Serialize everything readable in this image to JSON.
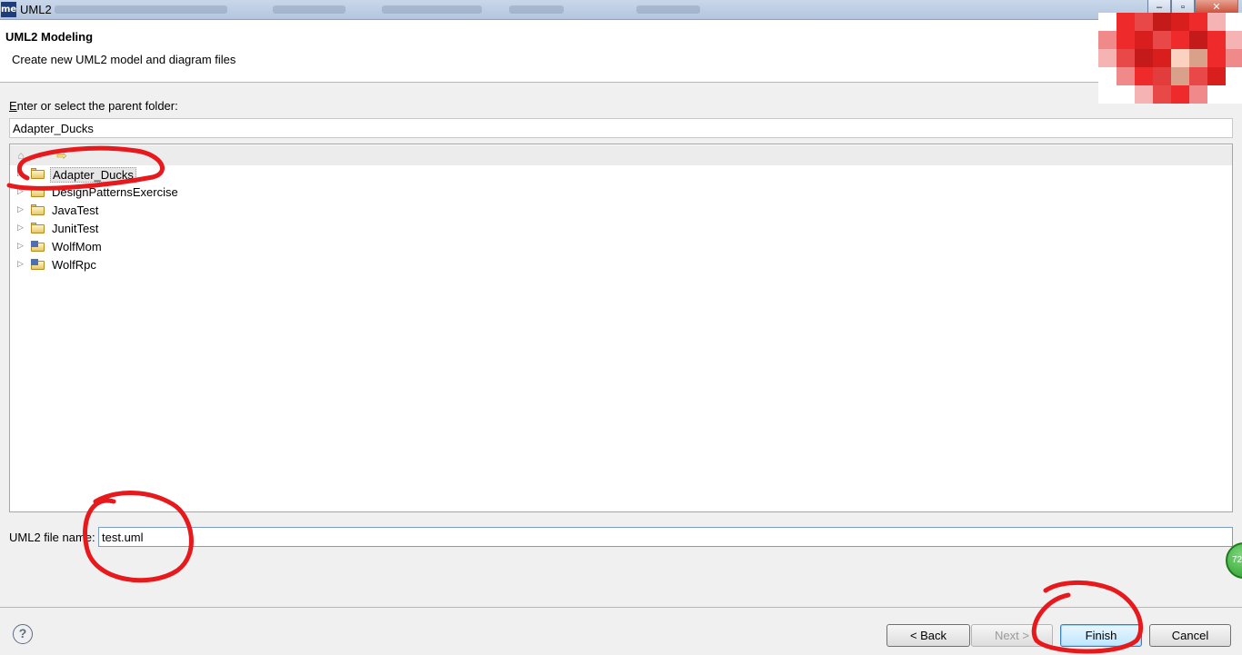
{
  "window": {
    "title": "UML2",
    "app_icon_text": "me",
    "minimize_glyph": "–",
    "maximize_glyph": "▫",
    "close_glyph": "✕"
  },
  "banner": {
    "title": "UML2 Modeling",
    "description": "Create new UML2 model and diagram files"
  },
  "parent_folder": {
    "label": "Enter or select the parent folder:",
    "value": "Adapter_Ducks"
  },
  "tree": {
    "toolbar": {
      "home_icon": "home-icon",
      "back_icon": "back-arrow-icon",
      "forward_icon": "forward-arrow-icon"
    },
    "items": [
      {
        "label": "Adapter_Ducks",
        "icon": "open-folder-icon",
        "selected": true
      },
      {
        "label": "DesignPatternsExercise",
        "icon": "open-folder-icon",
        "selected": false
      },
      {
        "label": "JavaTest",
        "icon": "open-folder-icon",
        "selected": false
      },
      {
        "label": "JunitTest",
        "icon": "open-folder-icon",
        "selected": false
      },
      {
        "label": "WolfMom",
        "icon": "java-project-icon",
        "selected": false
      },
      {
        "label": "WolfRpc",
        "icon": "java-project-icon",
        "selected": false
      }
    ]
  },
  "file_name": {
    "label": "UML2 file name:",
    "value": "test.uml"
  },
  "badge": {
    "text": "72"
  },
  "footer": {
    "help_icon": "help-icon",
    "help_glyph": "?",
    "back_label": "< Back",
    "next_label": "Next >",
    "finish_label": "Finish",
    "cancel_label": "Cancel"
  },
  "colors": {
    "annotation": "#e8191c",
    "tree_toolbar": "#ececec",
    "default_button": "#3c7fb1"
  }
}
